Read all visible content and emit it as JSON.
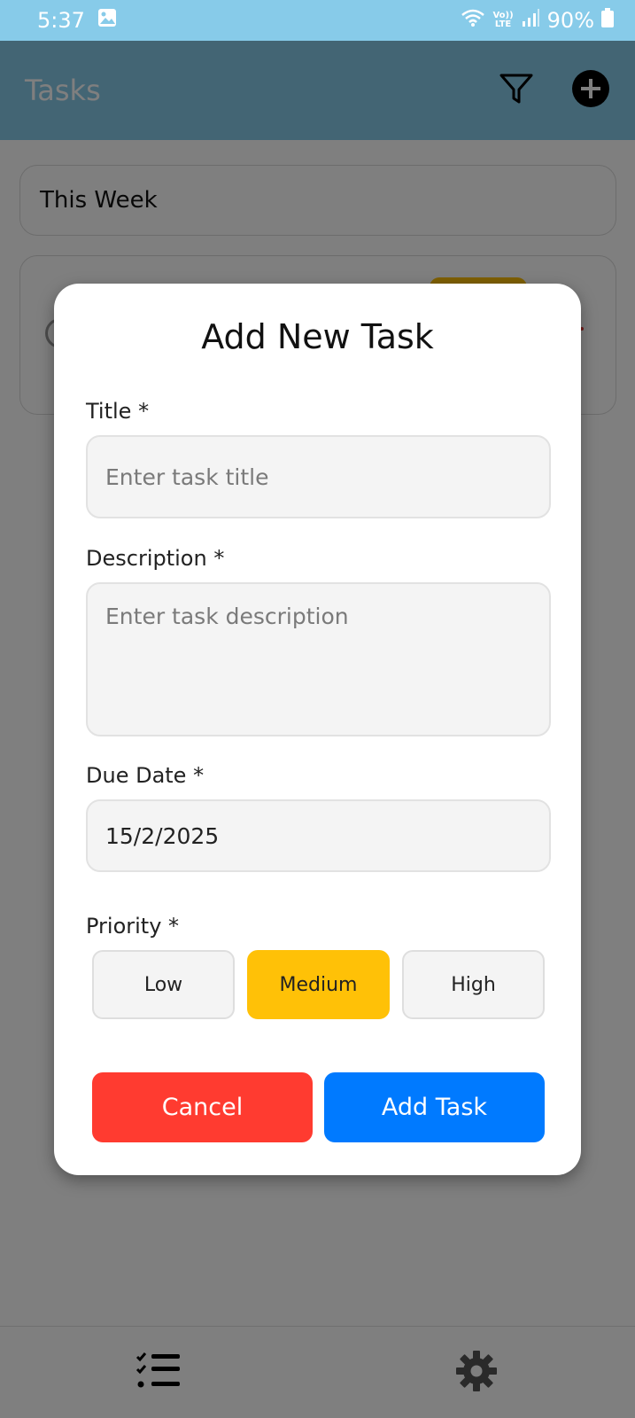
{
  "status_bar": {
    "time": "5:37",
    "volte": "Vo))",
    "lte": "LTE",
    "battery": "90%"
  },
  "header": {
    "title": "Tasks",
    "icons": [
      "filter-icon",
      "add-circle-icon"
    ]
  },
  "content": {
    "section_label": "This Week"
  },
  "modal": {
    "title": "Add New Task",
    "title_label": "Title *",
    "title_placeholder": "Enter task title",
    "description_label": "Description *",
    "description_placeholder": "Enter task description",
    "due_date_label": "Due Date *",
    "due_date_value": "15/2/2025",
    "priority_label": "Priority *",
    "priority_options": [
      "Low",
      "Medium",
      "High"
    ],
    "priority_selected": "Medium",
    "cancel_label": "Cancel",
    "add_label": "Add Task"
  },
  "bottom_nav": {
    "icons": [
      "task-list-icon",
      "settings-gear-icon"
    ]
  },
  "colors": {
    "header_bg": "#87cbe9",
    "priority_selected": "#ffc107",
    "cancel": "#ff3b30",
    "primary": "#007aff"
  }
}
